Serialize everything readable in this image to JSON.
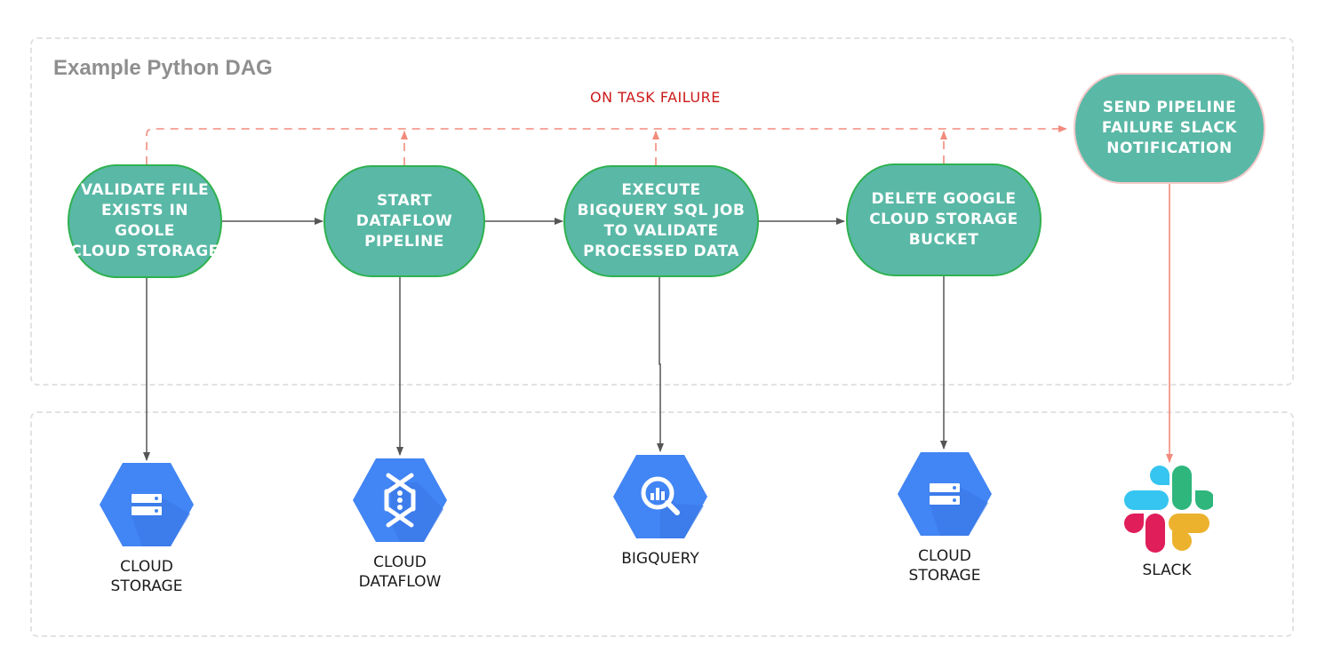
{
  "diagram": {
    "title": "Example Python DAG",
    "failure_label": "ON TASK FAILURE",
    "colors": {
      "node_fill": "#5ab8a6",
      "node_border": "#2fb14f",
      "failure_line": "#f28b7d",
      "failure_text": "#cc1a1a",
      "flow_line": "#555555",
      "gcp_blue": "#4285f4"
    },
    "tasks": [
      {
        "id": "validate",
        "label": "VALIDATE FILE\nEXISTS IN GOOLE\nCLOUD STORAGE"
      },
      {
        "id": "dataflow",
        "label": "START\nDATAFLOW\nPIPELINE"
      },
      {
        "id": "bigquery",
        "label": "EXECUTE\nBIGQUERY SQL JOB\nTO VALIDATE\nPROCESSED DATA"
      },
      {
        "id": "delete",
        "label": "DELETE GOOGLE\nCLOUD STORAGE\nBUCKET"
      },
      {
        "id": "slack",
        "label": "SEND PIPELINE\nFAILURE SLACK\nNOTIFICATION"
      }
    ],
    "services": [
      {
        "icon": "cloud-storage-icon",
        "label": "CLOUD\nSTORAGE"
      },
      {
        "icon": "cloud-dataflow-icon",
        "label": "CLOUD\nDATAFLOW"
      },
      {
        "icon": "bigquery-icon",
        "label": "BIGQUERY"
      },
      {
        "icon": "cloud-storage-icon",
        "label": "CLOUD\nSTORAGE"
      },
      {
        "icon": "slack-icon",
        "label": "SLACK"
      }
    ],
    "edges": [
      {
        "from": "validate",
        "to": "dataflow",
        "type": "success"
      },
      {
        "from": "dataflow",
        "to": "bigquery",
        "type": "success"
      },
      {
        "from": "bigquery",
        "to": "delete",
        "type": "success"
      },
      {
        "from": "validate",
        "to": "slack",
        "type": "failure"
      },
      {
        "from": "dataflow",
        "to": "slack",
        "type": "failure"
      },
      {
        "from": "bigquery",
        "to": "slack",
        "type": "failure"
      },
      {
        "from": "delete",
        "to": "slack",
        "type": "failure"
      }
    ]
  }
}
